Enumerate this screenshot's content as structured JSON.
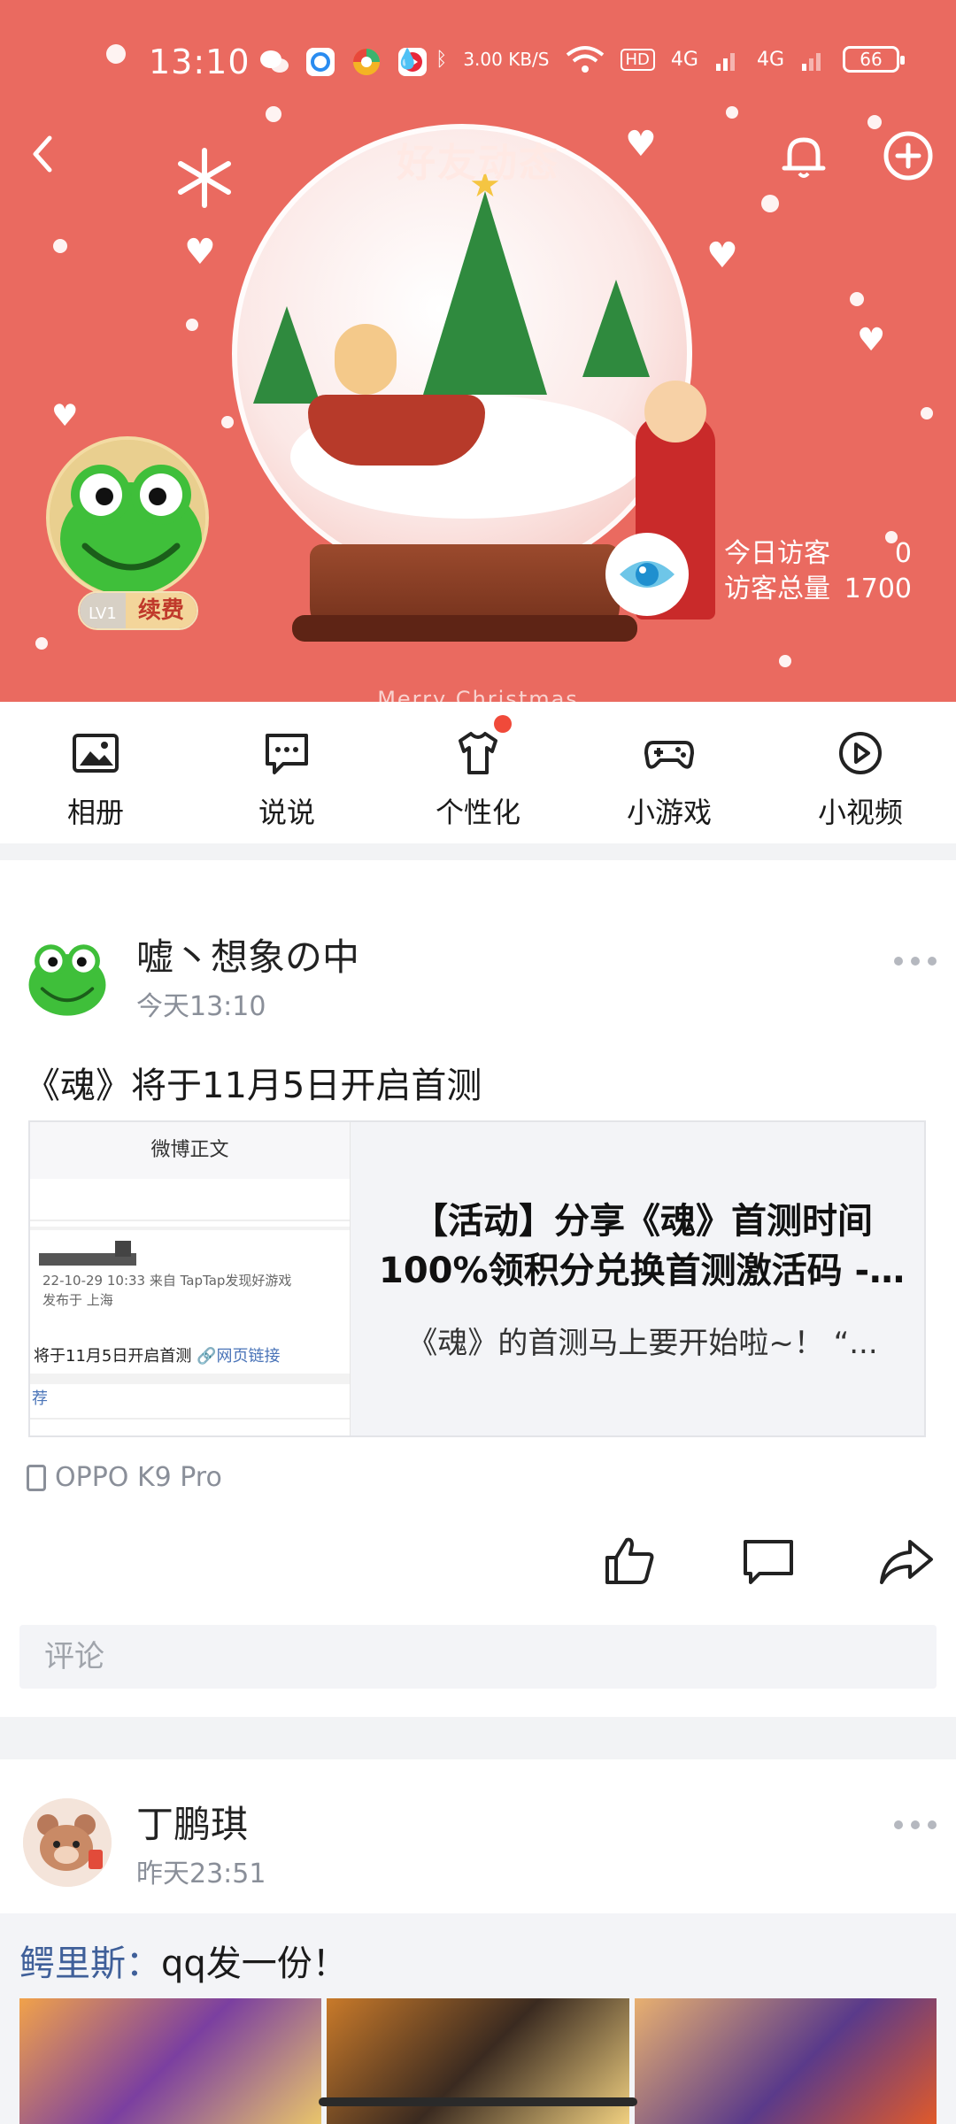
{
  "status_bar": {
    "time": "13:10",
    "speed": "3.00 KB/S",
    "network1": "4G",
    "network2": "4G",
    "battery": "66"
  },
  "header": {
    "title": "好友动态"
  },
  "profile": {
    "level": "LV1",
    "renew_label": "续费",
    "visitors_today_label": "今日访客",
    "visitors_today_value": "0",
    "visitors_total_label": "访客总量",
    "visitors_total_value": "1700",
    "cover_caption": "Merry Christmas"
  },
  "nav": {
    "items": [
      {
        "label": "相册",
        "icon": "album-icon"
      },
      {
        "label": "说说",
        "icon": "chat-bubble-icon"
      },
      {
        "label": "个性化",
        "icon": "shirt-icon",
        "badge": true
      },
      {
        "label": "小游戏",
        "icon": "gamepad-icon"
      },
      {
        "label": "小视频",
        "icon": "play-icon"
      }
    ]
  },
  "posts": [
    {
      "author": "嘘丶想象の中",
      "time": "今天13:10",
      "text": "《魂》将于11月5日开启首测",
      "link": {
        "thumb_header": "微博正文",
        "thumb_meta": "22-10-29 10:33 来自 TapTap发现好游戏",
        "thumb_loc": "发布于 上海",
        "thumb_text": "将于11月5日开启首测",
        "thumb_link": "🔗网页链接",
        "thumb_tail": "荐",
        "title_line1": "【活动】分享《魂》首测时间",
        "title_line2": "100%领积分兑换首测激活码 -...",
        "desc": "《魂》的首测马上要开始啦~！ “..."
      },
      "device": "OPPO K9 Pro",
      "comment_placeholder": "评论"
    },
    {
      "author": "丁鹏琪",
      "time": "昨天23:51",
      "repost_who": "鳄里斯",
      "repost_sep": "：",
      "repost_text": "qq发一份！"
    }
  ],
  "colors": {
    "cover_bg": "#ea6a60",
    "accent_red": "#f04a3a",
    "link_blue": "#3f5f99"
  }
}
